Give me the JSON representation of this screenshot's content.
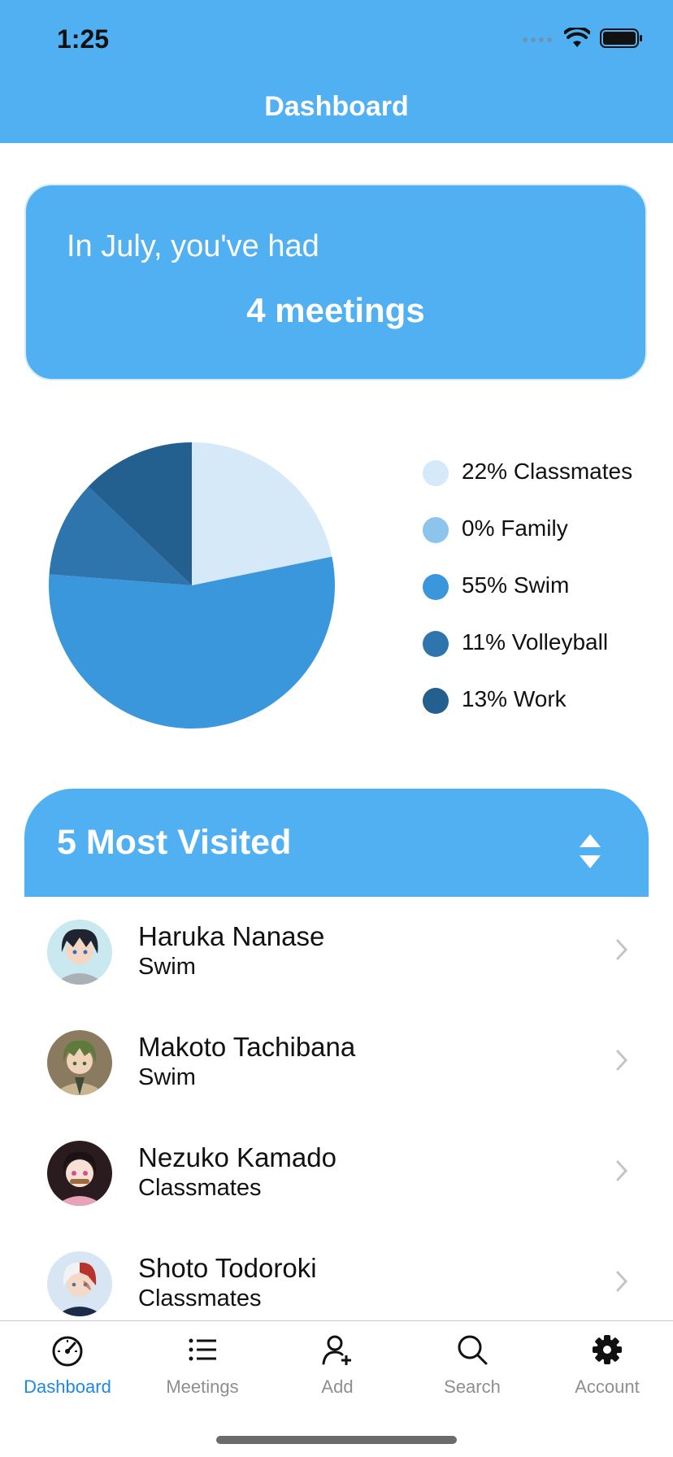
{
  "status_bar": {
    "time": "1:25"
  },
  "nav": {
    "title": "Dashboard"
  },
  "summary": {
    "line1": "In July, you've had",
    "line2": "4 meetings"
  },
  "chart_data": {
    "type": "pie",
    "slices": [
      {
        "label": "Classmates",
        "percent": 22,
        "legend": "22% Classmates",
        "color": "#d6e9f8"
      },
      {
        "label": "Family",
        "percent": 0,
        "legend": "0% Family",
        "color": "#8cc4eb"
      },
      {
        "label": "Swim",
        "percent": 55,
        "legend": "55% Swim",
        "color": "#3a97dc"
      },
      {
        "label": "Volleyball",
        "percent": 11,
        "legend": "11% Volleyball",
        "color": "#2e74ad"
      },
      {
        "label": "Work",
        "percent": 13,
        "legend": "13% Work",
        "color": "#235f8f"
      }
    ],
    "legend_position": "right"
  },
  "most_visited": {
    "title": "5 Most Visited",
    "items": [
      {
        "name": "Haruka Nanase",
        "group": "Swim"
      },
      {
        "name": "Makoto Tachibana",
        "group": "Swim"
      },
      {
        "name": "Nezuko Kamado",
        "group": "Classmates"
      },
      {
        "name": "Shoto Todoroki",
        "group": "Classmates"
      }
    ]
  },
  "tabs": [
    {
      "label": "Dashboard",
      "icon": "gauge-icon",
      "active": true
    },
    {
      "label": "Meetings",
      "icon": "list-icon",
      "active": false
    },
    {
      "label": "Add",
      "icon": "add-person-icon",
      "active": false
    },
    {
      "label": "Search",
      "icon": "search-icon",
      "active": false
    },
    {
      "label": "Account",
      "icon": "gear-icon",
      "active": false
    }
  ],
  "colors": {
    "accent": "#51b0f2",
    "active_tab": "#1e88e5",
    "inactive_tab": "#8e8e93"
  }
}
